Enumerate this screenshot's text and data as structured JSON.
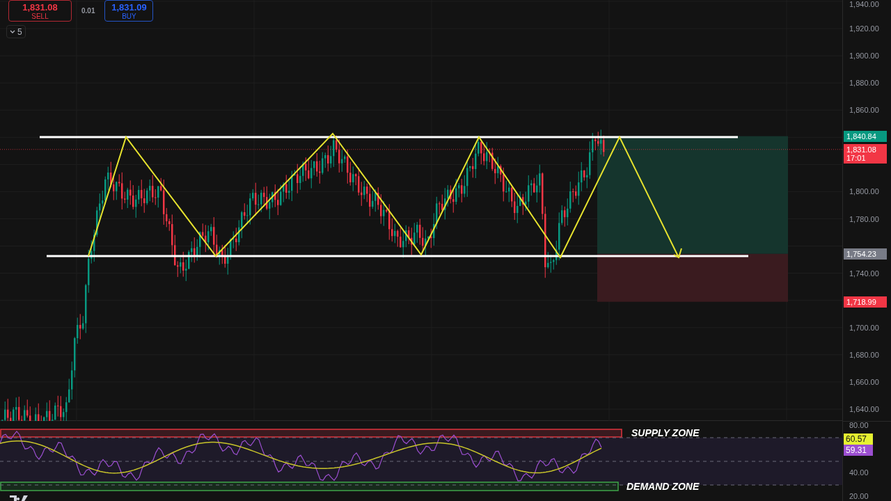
{
  "trade_panel": {
    "sell": {
      "price": "1,831.08",
      "label": "SELL"
    },
    "spread": "0.01",
    "buy": {
      "price": "1,831.09",
      "label": "BUY"
    }
  },
  "collapse_button": {
    "count": "5"
  },
  "price_axis": {
    "ticks": [
      "1,940.00",
      "1,920.00",
      "1,900.00",
      "1,880.00",
      "1,860.00",
      "1,800.00",
      "1,780.00",
      "1,740.00",
      "1,700.00",
      "1,680.00",
      "1,660.00",
      "1,640.00"
    ]
  },
  "price_tags": [
    {
      "lines": [
        "1,840.84"
      ],
      "color": "#089981"
    },
    {
      "lines": [
        "1,831.08",
        "17:01"
      ],
      "color": "#f23645"
    },
    {
      "lines": [
        "1,754.23"
      ],
      "color": "#787b86"
    },
    {
      "lines": [
        "1,718.99"
      ],
      "color": "#f23645"
    }
  ],
  "rsi_axis": {
    "ticks": [
      "80.00",
      "40.00",
      "20.00"
    ]
  },
  "rsi_tags": [
    {
      "text": "60.57",
      "color": "#e6f230"
    },
    {
      "text": "59.31",
      "color": "#9c4fd1"
    }
  ],
  "zone_labels": {
    "supply": "SUPPLY ZONE",
    "demand": "DEMAND ZONE"
  }
}
